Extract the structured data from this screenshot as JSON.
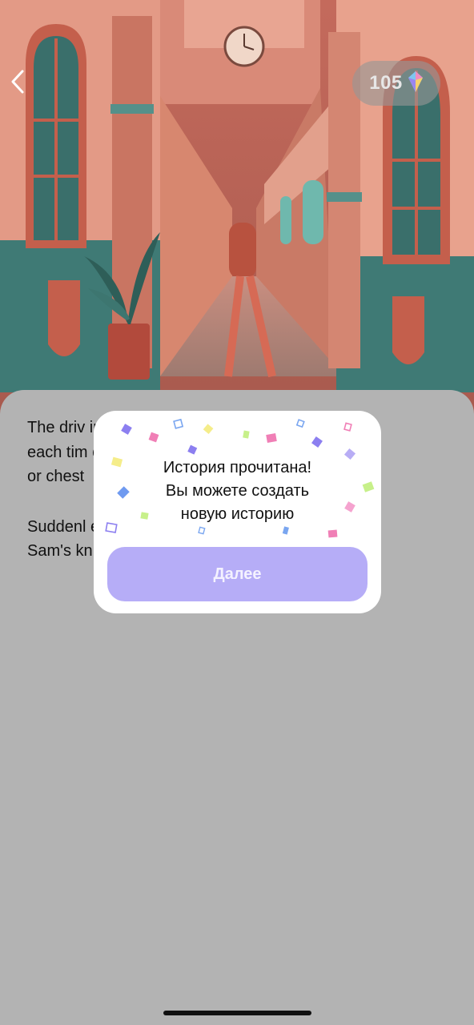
{
  "header": {
    "back_icon": "chevron-left-icon",
    "balance": "105",
    "balance_icon": "gem-icon"
  },
  "illustration": {
    "subject": "pink and teal corridor with arched windows, clock and potted plant"
  },
  "story": {
    "paragraph_1": "The driv                                                      indow\neach tim                                                       oulder\nor chest",
    "paragraph_2": "Suddenl                                                        es\nSam's kn"
  },
  "modal": {
    "message": "История прочитана!\nВы можете создать\nновую историю",
    "next_label": "Далее"
  },
  "colors": {
    "overlay": "#b3b3b3",
    "button": "#b6adf7",
    "button_text": "#f4f2ff"
  }
}
